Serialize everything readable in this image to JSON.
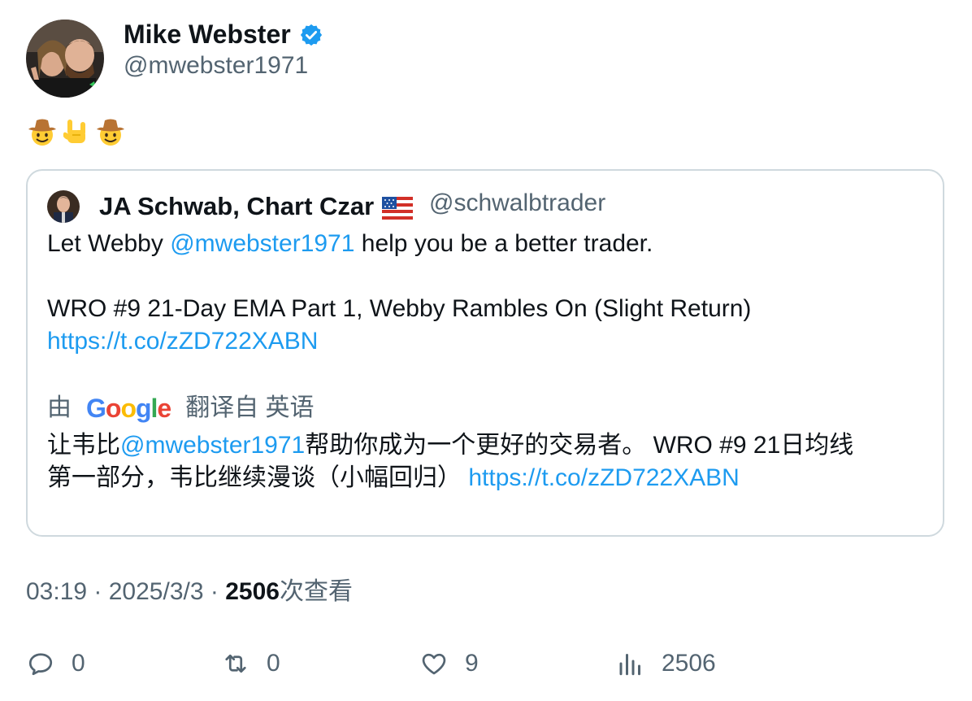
{
  "author": {
    "name": "Mike Webster",
    "handle": "@mwebster1971",
    "verified_icon": "verified-badge-icon"
  },
  "tweet": {
    "emojis": [
      "cowboy-hat-face",
      "sign-of-horns",
      "cowboy-hat-face"
    ]
  },
  "quoted": {
    "name": "JA Schwab, Chart Czar",
    "flag": "us-flag",
    "handle": "@schwalbtrader",
    "text_line1_prefix": "Let Webby ",
    "text_line1_mention": "@mwebster1971",
    "text_line1_suffix": " help you be a better trader.",
    "text_line2": "WRO #9 21-Day EMA Part 1, Webby Rambles On (Slight Return)",
    "text_link": "https://t.co/zZD722XABN",
    "translation": {
      "by_prefix": "由",
      "provider": "Google",
      "by_suffix": "翻译自 英语",
      "line1_prefix": "让韦比",
      "line1_mention": "@mwebster1971",
      "line1_suffix": "帮助你成为一个更好的交易者。 WRO #9 21日均线",
      "line2_text": "第一部分，韦比继续漫谈（小幅回归） ",
      "line2_link": "https://t.co/zZD722XABN"
    }
  },
  "meta": {
    "time": "03:19",
    "sep1": " · ",
    "date": "2025/3/3",
    "sep2": " · ",
    "views_count": "2506",
    "views_label": "次查看"
  },
  "actions": {
    "reply_count": "0",
    "retweet_count": "0",
    "like_count": "9",
    "views_count": "2506"
  },
  "colors": {
    "link": "#1d9bf0",
    "secondary_text": "#536471",
    "border": "#cfd9de",
    "verified": "#1d9bf0"
  }
}
